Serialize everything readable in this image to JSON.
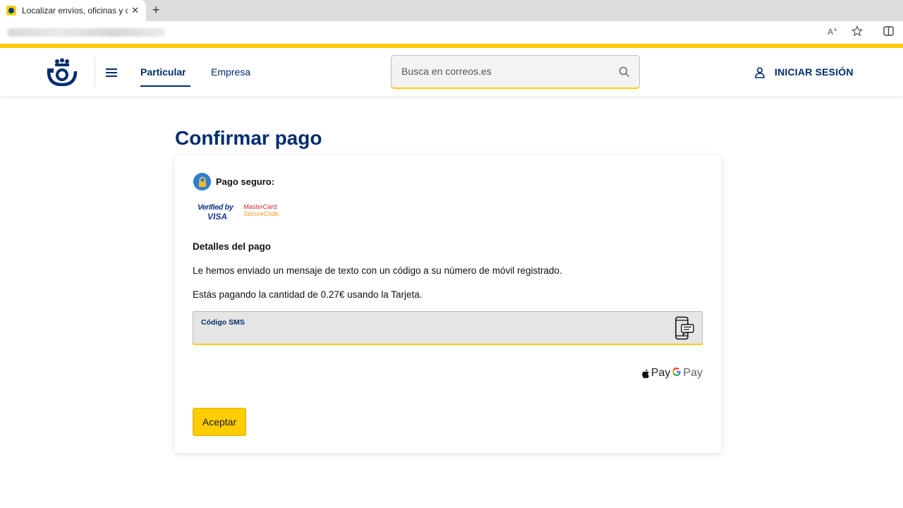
{
  "browser": {
    "tab_title": "Localizar envíos, oficinas y código",
    "tab_close": "✕",
    "new_tab": "+"
  },
  "header": {
    "nav": {
      "particular": "Particular",
      "empresa": "Empresa"
    },
    "search": {
      "placeholder": "Busca en correos.es"
    },
    "login_label": "INICIAR SESIÓN"
  },
  "main": {
    "title": "Confirmar pago",
    "secure_label": "Pago seguro:",
    "security_logos": {
      "visa_top": "Verified by",
      "visa_bottom": "VISA",
      "mc_top": "MasterCard.",
      "mc_bottom": "SecureCode."
    },
    "details_title": "Detalles del pago",
    "message_sms": "Le hemos enviado un mensaje de texto con un código a su número de móvil registrado.",
    "message_amount": "Estás pagando la cantidad de 0.27€ usando la Tarjeta.",
    "sms_field": {
      "label": "Código SMS",
      "value": ""
    },
    "pay_logos": {
      "apple_pay": "Pay",
      "google_g": "G",
      "google_pay": "Pay"
    },
    "accept_label": "Aceptar"
  },
  "colors": {
    "brand_yellow": "#ffcd00",
    "brand_blue": "#002d6e"
  }
}
